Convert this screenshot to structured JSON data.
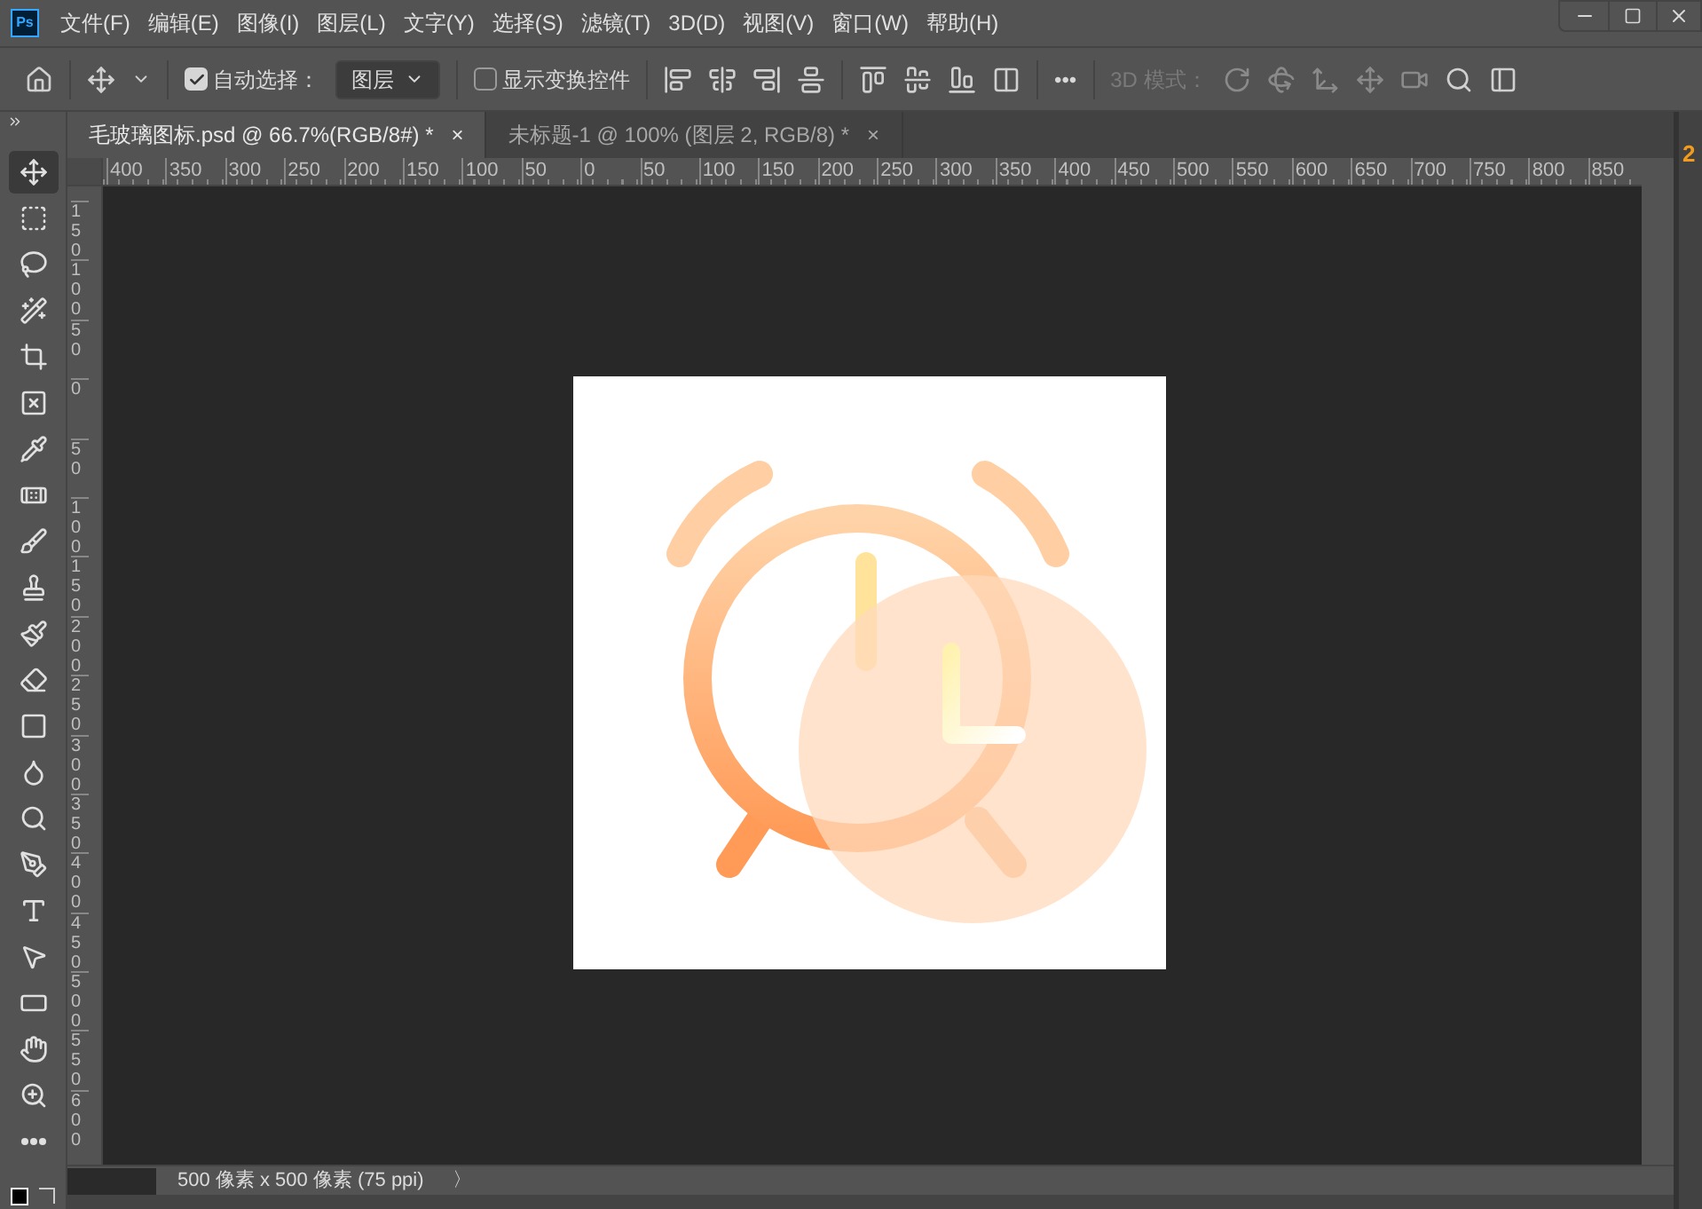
{
  "menu_bar": {
    "app_logo": "Ps",
    "items": [
      "文件(F)",
      "编辑(E)",
      "图像(I)",
      "图层(L)",
      "文字(Y)",
      "选择(S)",
      "滤镜(T)",
      "3D(D)",
      "视图(V)",
      "窗口(W)",
      "帮助(H)"
    ]
  },
  "options_bar": {
    "auto_select": {
      "label": "自动选择：",
      "checked": true
    },
    "target": {
      "value": "图层"
    },
    "show_transform": {
      "label": "显示变换控件",
      "checked": false
    },
    "more": "•••",
    "mode_3d": {
      "label": "3D 模式：",
      "disabled": true
    }
  },
  "tabs": [
    {
      "label": "毛玻璃图标.psd @ 66.7%(RGB/8#) *",
      "selected": true,
      "close": "×"
    },
    {
      "label": "未标题-1 @ 100% (图层 2, RGB/8) *",
      "selected": false,
      "close": "×"
    }
  ],
  "tools": [
    {
      "selected": true
    },
    {
      "selected": false
    },
    {
      "selected": false
    },
    {
      "selected": false
    },
    {
      "selected": false
    },
    {
      "selected": false
    },
    {
      "selected": false
    },
    {
      "selected": false
    },
    {
      "selected": false
    },
    {
      "selected": false
    },
    {
      "selected": false
    },
    {
      "selected": false
    },
    {
      "selected": false
    },
    {
      "selected": false
    },
    {
      "selected": false
    },
    {
      "selected": false
    },
    {
      "selected": false
    },
    {
      "selected": false
    },
    {
      "selected": false
    },
    {
      "selected": false
    },
    {
      "selected": false
    },
    {
      "selected": false
    }
  ],
  "ruler_horizontal": [
    "400",
    "350",
    "300",
    "250",
    "200",
    "150",
    "100",
    "50",
    "0",
    "50",
    "100",
    "150",
    "200",
    "250",
    "300",
    "350",
    "400",
    "450",
    "500",
    "550",
    "600",
    "650",
    "700",
    "750",
    "800",
    "850"
  ],
  "ruler_vertical": [
    "150",
    "100",
    "50",
    "0",
    "50",
    "100",
    "150",
    "200",
    "250",
    "300",
    "350",
    "400",
    "450",
    "500",
    "550",
    "600"
  ],
  "status_bar": {
    "info": "500 像素 x 500 像素 (75 ppi)",
    "arrow": "〉"
  },
  "right_panel": {
    "label": "2"
  }
}
